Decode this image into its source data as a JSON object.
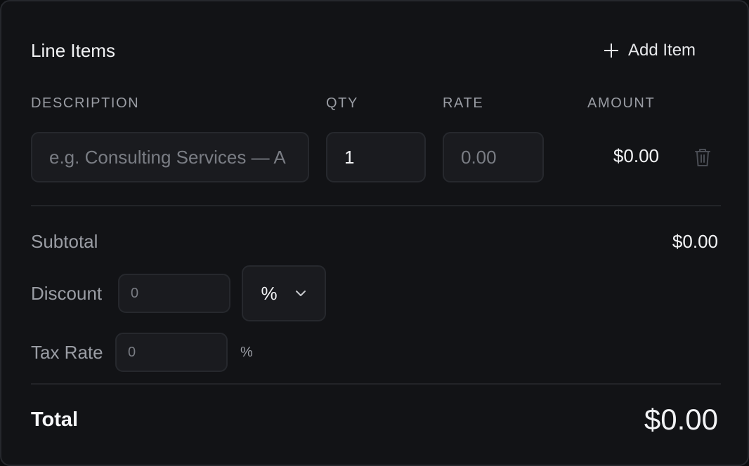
{
  "header": {
    "title": "Line Items",
    "add_label": "Add Item"
  },
  "columns": {
    "description": "DESCRIPTION",
    "qty": "QTY",
    "rate": "RATE",
    "amount": "AMOUNT"
  },
  "line_items": [
    {
      "description_value": "",
      "description_placeholder": "e.g. Consulting Services — A",
      "qty_value": "1",
      "rate_value": "",
      "rate_placeholder": "0.00",
      "amount": "$0.00"
    }
  ],
  "summary": {
    "subtotal_label": "Subtotal",
    "subtotal_value": "$0.00",
    "discount_label": "Discount",
    "discount_placeholder": "0",
    "discount_type": "%",
    "tax_label": "Tax Rate",
    "tax_placeholder": "0",
    "tax_unit": "%",
    "total_label": "Total",
    "total_value": "$0.00"
  },
  "icons": {
    "add": "plus-icon",
    "delete": "trash-icon",
    "dropdown": "chevron-down-icon"
  },
  "colors": {
    "background": "#121316",
    "border": "#26282d",
    "field_bg": "#1a1b1f",
    "text_primary": "#f2f3f5",
    "text_muted": "#9a9da4"
  }
}
